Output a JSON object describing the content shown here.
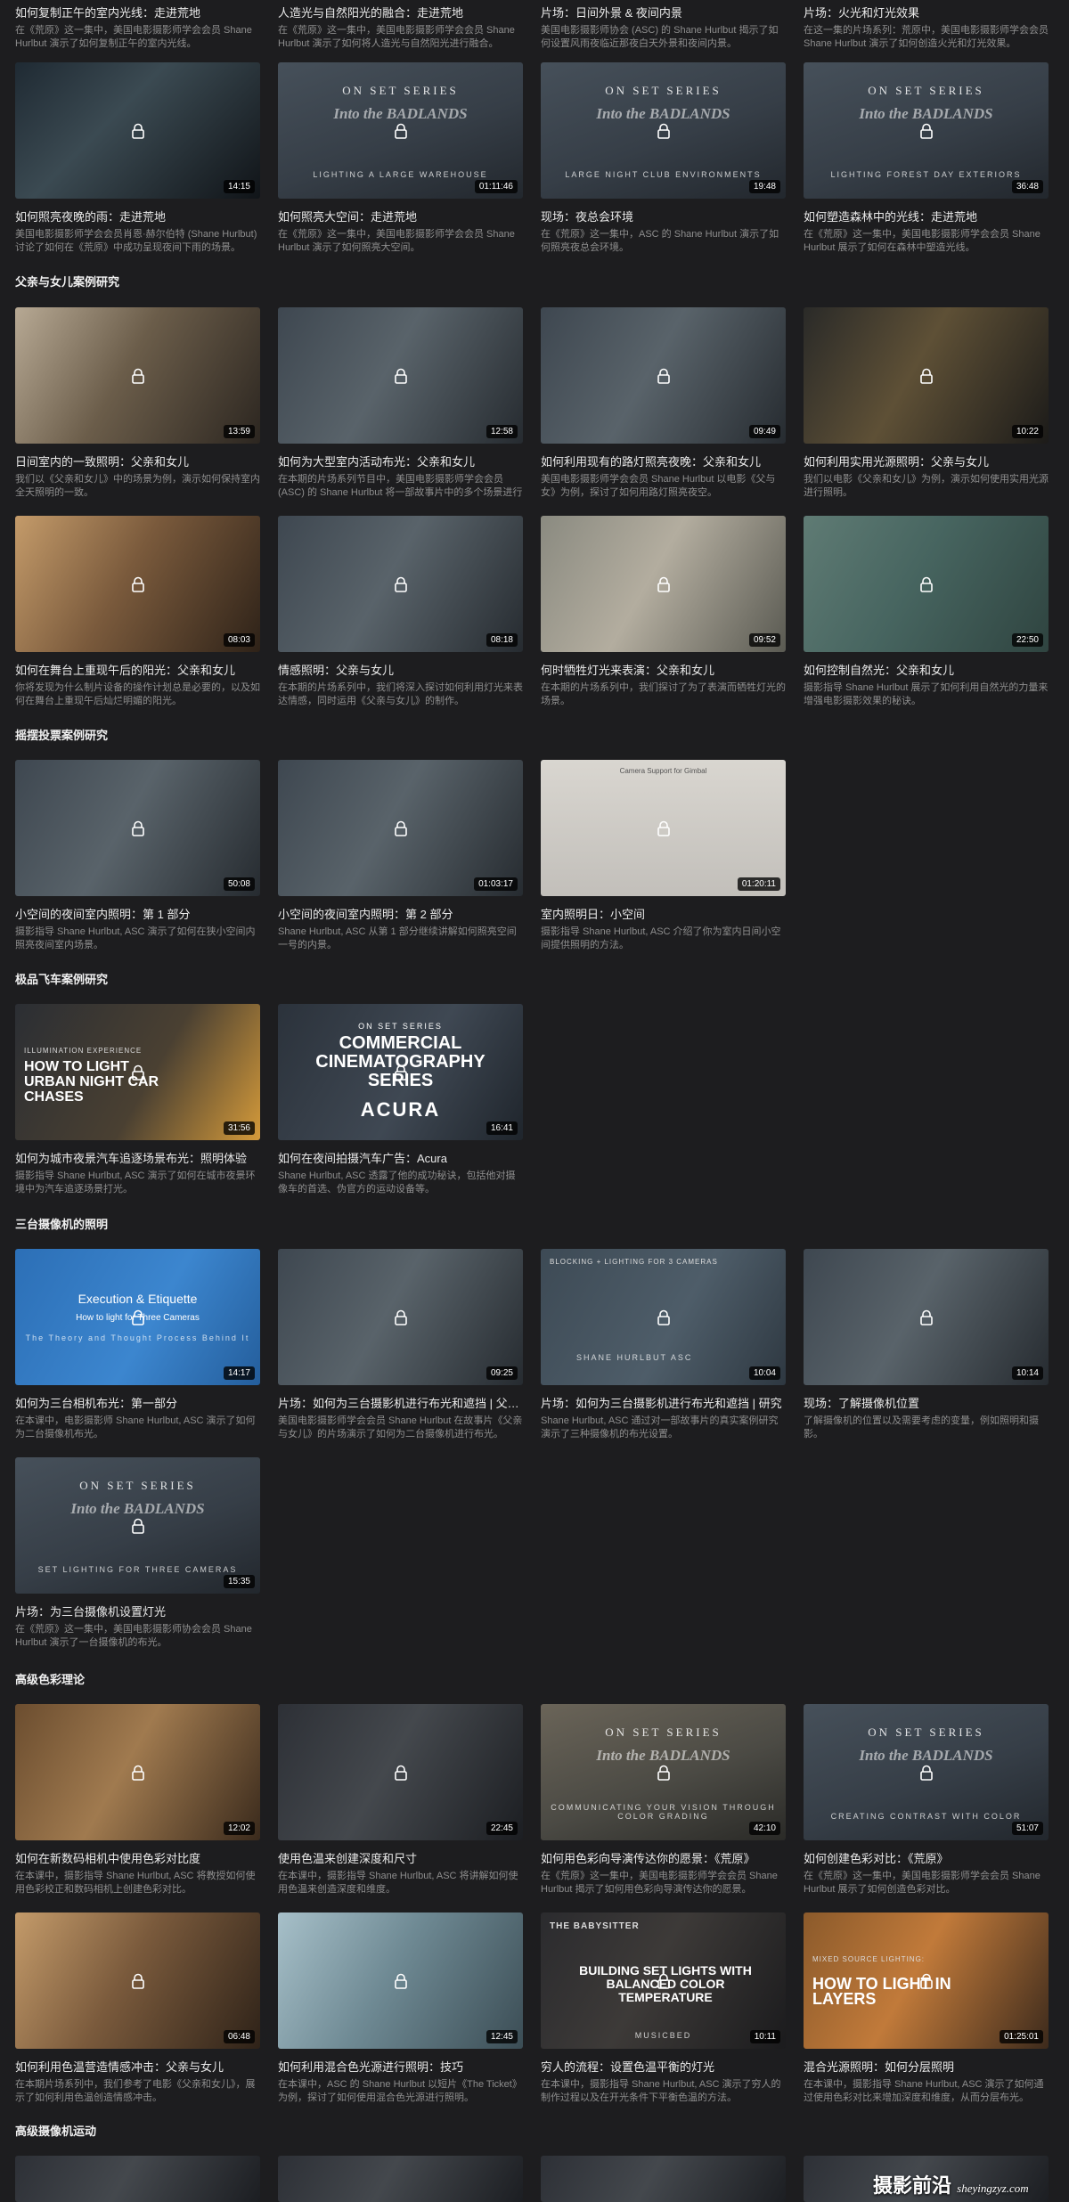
{
  "top_partial": [
    {
      "title": "如何复制正午的室内光线：走进荒地",
      "desc": "在《荒原》这一集中，美国电影摄影师学会会员 Shane Hurlbut 演示了如何复制正午的室内光线。"
    },
    {
      "title": "人造光与自然阳光的融合：走进荒地",
      "desc": "在《荒原》这一集中，美国电影摄影师学会会员 Shane Hurlbut 演示了如何将人造光与自然阳光进行融合。"
    },
    {
      "title": "片场：日间外景 & 夜间内景",
      "desc": "美国电影摄影师协会 (ASC) 的 Shane Hurlbut 揭示了如何设置风雨夜临近那夜白天外景和夜间内景。"
    },
    {
      "title": "片场：火光和灯光效果",
      "desc": "在这一集的片场系列：荒原中，美国电影摄影师学会会员 Shane Hurlbut 演示了如何创造火光和灯光效果。"
    }
  ],
  "sections": [
    {
      "title": "",
      "cards": [
        {
          "title": "如何照亮夜晚的雨：走进荒地",
          "desc": "美国电影摄影师学会会员肖恩·赫尔伯特 (Shane Hurlbut) 讨论了如何在《荒原》中成功呈现夜间下雨的场景。",
          "duration": "14:15",
          "style": "rain"
        },
        {
          "title": "如何照亮大空间：走进荒地",
          "desc": "在《荒原》这一集中，美国电影摄影师学会会员 Shane Hurlbut 演示了如何照亮大空间。",
          "duration": "01:11:46",
          "style": "onset",
          "overlay_sub": "LIGHTING A LARGE WAREHOUSE"
        },
        {
          "title": "现场：夜总会环境",
          "desc": "在《荒原》这一集中，ASC 的 Shane Hurlbut 演示了如何照亮夜总会环境。",
          "duration": "19:48",
          "style": "onset",
          "overlay_sub": "LARGE NIGHT CLUB ENVIRONMENTS"
        },
        {
          "title": "如何塑造森林中的光线：走进荒地",
          "desc": "在《荒原》这一集中，美国电影摄影师学会会员 Shane Hurlbut 展示了如何在森林中塑造光线。",
          "duration": "36:48",
          "style": "onset",
          "overlay_sub": "LIGHTING FOREST DAY EXTERIORS"
        }
      ]
    },
    {
      "title": "父亲与女儿案例研究",
      "cards": [
        {
          "title": "日间室内的一致照明：父亲和女儿",
          "desc": "我们以《父亲和女儿》中的场景为例，演示如何保持室内全天照明的一致。",
          "duration": "13:59",
          "style": "stair"
        },
        {
          "title": "如何为大型室内活动布光：父亲和女儿",
          "desc": "在本期的片场系列节目中，美国电影摄影师学会会员 (ASC) 的 Shane Hurlbut 将一部故事片中的多个场景进行了布光。",
          "duration": "12:58",
          "style": "office"
        },
        {
          "title": "如何利用现有的路灯照亮夜晚：父亲和女儿",
          "desc": "美国电影摄影师学会会员 Shane Hurlbut 以电影《父与女》为例，探讨了如何用路灯照亮夜空。",
          "duration": "09:49",
          "style": "office"
        },
        {
          "title": "如何利用实用光源照明：父亲与女儿",
          "desc": "我们以电影《父亲和女儿》为例，演示如何使用实用光源进行照明。",
          "duration": "10:22",
          "style": "bar"
        }
      ]
    },
    {
      "title": "",
      "cards": [
        {
          "title": "如何在舞台上重现午后的阳光：父亲和女儿",
          "desc": "你将发现为什么制片设备的操作计划总是必要的，以及如何在舞台上重现午后灿烂明媚的阳光。",
          "duration": "08:03",
          "style": "bath"
        },
        {
          "title": "情感照明：父亲与女儿",
          "desc": "在本期的片场系列中，我们将深入探讨如何利用灯光来表达情感，同时运用《父亲与女儿》的制作。",
          "duration": "08:18",
          "style": "office"
        },
        {
          "title": "何时牺牲灯光来表演：父亲和女儿",
          "desc": "在本期的片场系列中，我们探讨了为了表演而牺牲灯光的场景。",
          "duration": "09:52",
          "style": "street"
        },
        {
          "title": "如何控制自然光：父亲和女儿",
          "desc": "摄影指导 Shane Hurlbut 展示了如何利用自然光的力量来增强电影摄影效果的秘诀。",
          "duration": "22:50",
          "style": "green"
        }
      ]
    },
    {
      "title": "摇摆投票案例研究",
      "cards": [
        {
          "title": "小空间的夜间室内照明：第 1 部分",
          "desc": "摄影指导 Shane Hurlbut, ASC 演示了如何在狭小空间内照亮夜间室内场景。",
          "duration": "50:08",
          "style": "office"
        },
        {
          "title": "小空间的夜间室内照明：第 2 部分",
          "desc": "Shane Hurlbut, ASC 从第 1 部分继续讲解如何照亮空间一号的内景。",
          "duration": "01:03:17",
          "style": "office"
        },
        {
          "title": "室内照明日：小空间",
          "desc": "摄影指导 Shane Hurlbut, ASC 介绍了你为室内日间小空间提供照明的方法。",
          "duration": "01:20:11",
          "style": "gear",
          "overlay_top": "Camera Support for Gimbal"
        }
      ]
    },
    {
      "title": "极品飞车案例研究",
      "cards": [
        {
          "title": "如何为城市夜景汽车追逐场景布光：照明体验",
          "desc": "摄影指导 Shane Hurlbut, ASC 演示了如何在城市夜景环境中为汽车追逐场景打光。",
          "duration": "31:56",
          "style": "carchase",
          "overlay_small": "ILLUMINATION EXPERIENCE",
          "overlay_big": "HOW TO LIGHT URBAN NIGHT CAR CHASES"
        },
        {
          "title": "如何在夜间拍摄汽车广告：Acura",
          "desc": "Shane Hurlbut, ASC 透露了他的成功秘诀，包括他对摄像车的首选、伪官方的运动设备等。",
          "duration": "16:41",
          "style": "acura",
          "overlay_small": "ON SET SERIES",
          "overlay_big": "COMMERCIAL CINEMATOGRAPHY SERIES",
          "overlay_brand": "ACURA"
        }
      ]
    },
    {
      "title": "三台摄像机的照明",
      "cards": [
        {
          "title": "如何为三台相机布光：第一部分",
          "desc": "在本课中，电影摄影师 Shane Hurlbut, ASC 演示了如何为二台摄像机布光。",
          "duration": "14:17",
          "style": "blue",
          "overlay_big": "Execution & Etiquette",
          "overlay_small": "How to light for Three Cameras",
          "overlay_sub": "The Theory and Thought Process Behind It"
        },
        {
          "title": "片场：如何为三台摄影机进行布光和遮挡 | 父亲和女儿",
          "desc": "美国电影摄影师学会会员 Shane Hurlbut 在故事片《父亲与女儿》的片场演示了如何为二台摄像机进行布光。",
          "duration": "09:25",
          "style": "office"
        },
        {
          "title": "片场：如何为三台摄影机进行布光和遮挡 | 研究",
          "desc": "Shane Hurlbut, ASC 通过对一部故事片的真实案例研究演示了三种摄像机的布光设置。",
          "duration": "10:04",
          "style": "wave",
          "overlay_small": "BLOCKING + LIGHTING FOR 3 CAMERAS",
          "overlay_sub": "SHANE HURLBUT ASC"
        },
        {
          "title": "现场：了解摄像机位置",
          "desc": "了解摄像机的位置以及需要考虑的变量，例如照明和摄影。",
          "duration": "10:14",
          "style": "office"
        }
      ]
    },
    {
      "title": "",
      "cards": [
        {
          "title": "片场：为三台摄像机设置灯光",
          "desc": "在《荒原》这一集中，美国电影摄影师协会会员 Shane Hurlbut 演示了一台摄像机的布光。",
          "duration": "15:35",
          "style": "onset",
          "overlay_sub": "SET LIGHTING FOR THREE CAMERAS"
        }
      ]
    },
    {
      "title": "高级色彩理论",
      "cards": [
        {
          "title": "如何在新数码相机中使用色彩对比度",
          "desc": "在本课中，摄影指导 Shane Hurlbut, ASC 将教授如何使用色彩校正和数码相机上创建色彩对比。",
          "duration": "12:02",
          "style": "dinner"
        },
        {
          "title": "使用色温来创建深度和尺寸",
          "desc": "在本课中，摄影指导 Shane Hurlbut, ASC 将讲解如何使用色温来创造深度和维度。",
          "duration": "22:45",
          "style": "night"
        },
        {
          "title": "如何用色彩向导演传达你的愿景：《荒原》",
          "desc": "在《荒原》这一集中，美国电影摄影师学会会员 Shane Hurlbut 揭示了如何用色彩向导演传达你的愿景。",
          "duration": "42:10",
          "style": "onset-warm",
          "overlay_sub": "COMMUNICATING YOUR VISION THROUGH COLOR GRADING"
        },
        {
          "title": "如何创建色彩对比：《荒原》",
          "desc": "在《荒原》这一集中，美国电影摄影师学会会员 Shane Hurlbut 展示了如何创造色彩对比。",
          "duration": "51:07",
          "style": "onset",
          "overlay_sub": "CREATING CONTRAST WITH COLOR"
        }
      ]
    },
    {
      "title": "",
      "cards": [
        {
          "title": "如何利用色温营造情感冲击：父亲与女儿",
          "desc": "在本期片场系列中，我们参考了电影《父亲和女儿》，展示了如何利用色温创造情感冲击。",
          "duration": "06:48",
          "style": "bath"
        },
        {
          "title": "如何利用混合色光源进行照明：技巧",
          "desc": "在本课中，ASC 的 Shane Hurlbut 以短片《The Ticket》为例，探讨了如何使用混合色光源进行照明。",
          "duration": "12:45",
          "style": "face"
        },
        {
          "title": "穷人的流程：设置色温平衡的灯光",
          "desc": "在本课中，摄影指导 Shane Hurlbut, ASC 演示了穷人的制作过程以及在开光条件下平衡色温的方法。",
          "duration": "10:11",
          "style": "babysitter",
          "overlay_small": "THE BABYSITTER",
          "overlay_big": "BUILDING SET LIGHTS WITH BALANCED COLOR TEMPERATURE",
          "overlay_sub": "MUSICBED"
        },
        {
          "title": "混合光源照明：如何分层照明",
          "desc": "在本课中，摄影指导 Shane Hurlbut, ASC 演示了如何通过使用色彩对比来增加深度和维度，从而分层布光。",
          "duration": "01:25:01",
          "style": "layers",
          "overlay_small": "MIXED SOURCE LIGHTING:",
          "overlay_big": "HOW TO LIGHT IN LAYERS"
        }
      ]
    },
    {
      "title": "高级摄像机运动",
      "cards": []
    }
  ],
  "onset_label": "ON SET SERIES",
  "onset_logo": "Into the BADLANDS",
  "watermark": {
    "text": "摄影前沿",
    "url": "sheyingzyz.com"
  }
}
